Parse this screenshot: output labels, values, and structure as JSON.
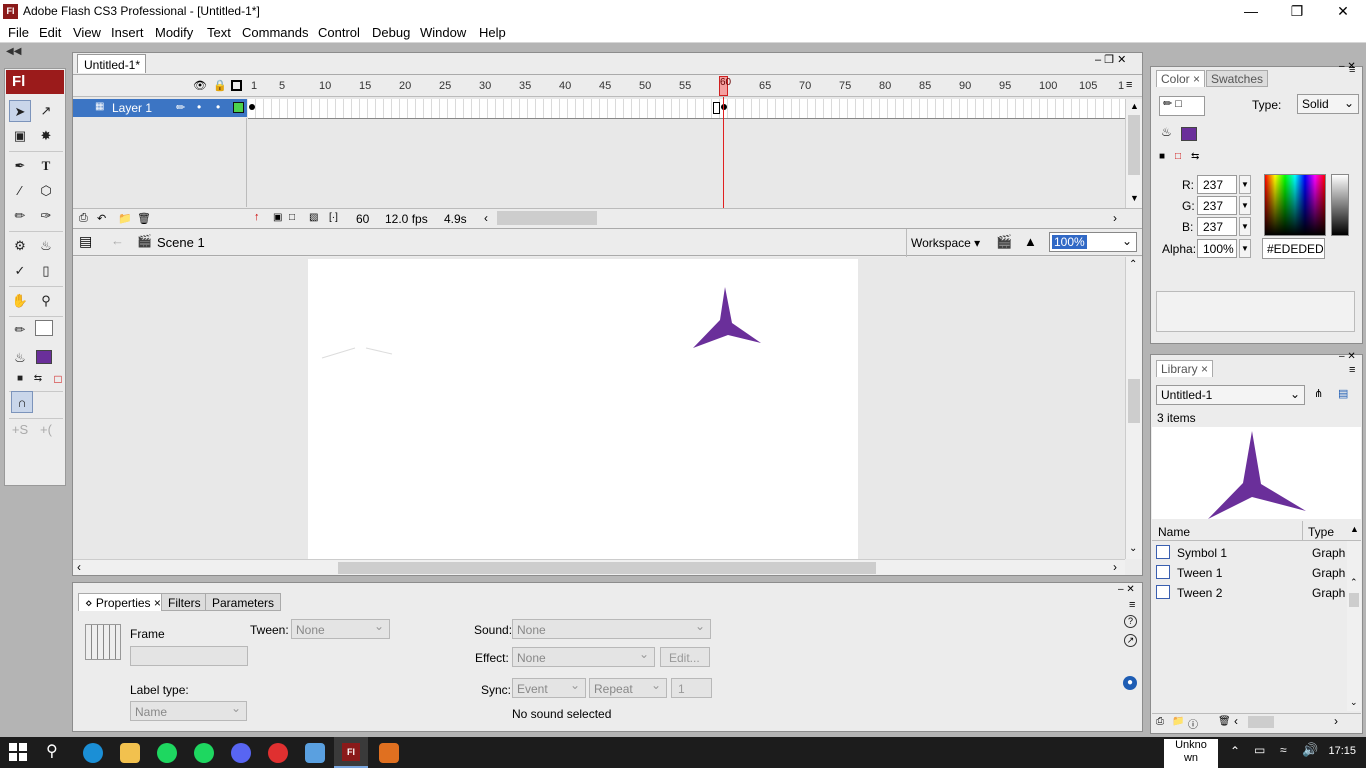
{
  "window": {
    "title": "Adobe Flash CS3 Professional - [Untitled-1*]",
    "app_icon_label": "Fl"
  },
  "menu": [
    "File",
    "Edit",
    "View",
    "Insert",
    "Modify",
    "Text",
    "Commands",
    "Control",
    "Debug",
    "Window",
    "Help"
  ],
  "tools": {
    "logo": "Fl"
  },
  "document": {
    "tab": "Untitled-1*"
  },
  "timeline": {
    "frame_numbers": [
      "1",
      "5",
      "10",
      "15",
      "20",
      "25",
      "30",
      "35",
      "40",
      "45",
      "50",
      "55",
      "60",
      "65",
      "70",
      "75",
      "80",
      "85",
      "90",
      "95",
      "100",
      "105",
      "1"
    ],
    "current_frame_marker": "60",
    "layer_name": "Layer 1",
    "current_frame": "60",
    "fps": "12.0 fps",
    "elapsed": "4.9s"
  },
  "editbar": {
    "scene": "Scene 1",
    "workspace": "Workspace",
    "zoom": "100%"
  },
  "properties": {
    "tabs": [
      "Properties",
      "Filters",
      "Parameters"
    ],
    "frame_label": "Frame",
    "tween_label": "Tween:",
    "tween_value": "None",
    "label_type_label": "Label type:",
    "label_type_value": "Name",
    "sound_label": "Sound:",
    "sound_value": "None",
    "effect_label": "Effect:",
    "effect_value": "None",
    "edit_button": "Edit...",
    "sync_label": "Sync:",
    "sync_value": "Event",
    "repeat_value": "Repeat",
    "repeat_count": "1",
    "sound_status": "No sound selected"
  },
  "color_panel": {
    "tabs": [
      "Color",
      "Swatches"
    ],
    "type_label": "Type:",
    "type_value": "Solid",
    "r_label": "R:",
    "r_value": "237",
    "g_label": "G:",
    "g_value": "237",
    "b_label": "B:",
    "b_value": "237",
    "alpha_label": "Alpha:",
    "alpha_value": "100%",
    "hex_value": "#EDEDED",
    "fill_color": "#6a2f9a"
  },
  "library_panel": {
    "tab": "Library",
    "document_select": "Untitled-1",
    "item_count": "3 items",
    "col_name": "Name",
    "col_type": "Type",
    "items": [
      {
        "name": "Symbol 1",
        "type": "Graph"
      },
      {
        "name": "Tween 1",
        "type": "Graph"
      },
      {
        "name": "Tween 2",
        "type": "Graph"
      }
    ]
  },
  "taskbar": {
    "tray_label": "Unknown",
    "tray_label_line1": "Unkno",
    "tray_label_line2": "wn",
    "clock": "17:15"
  }
}
